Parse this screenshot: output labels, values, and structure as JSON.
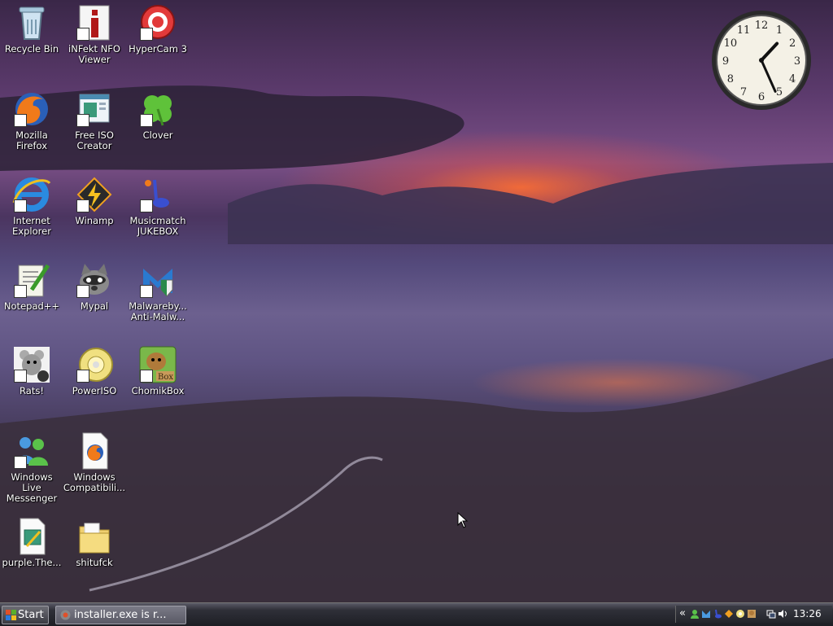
{
  "desktop": {
    "icons": [
      {
        "label": "Recycle Bin",
        "icon": "recycle-bin-icon"
      },
      {
        "label": "iNFekt NFO Viewer",
        "icon": "infekt-icon"
      },
      {
        "label": "HyperCam 3",
        "icon": "hypercam-icon"
      },
      {
        "label": "Mozilla Firefox",
        "icon": "firefox-icon"
      },
      {
        "label": "Free ISO Creator",
        "icon": "iso-creator-icon"
      },
      {
        "label": "Clover",
        "icon": "clover-icon"
      },
      {
        "label": "Internet Explorer",
        "icon": "internet-explorer-icon"
      },
      {
        "label": "Winamp",
        "icon": "winamp-icon"
      },
      {
        "label": "Musicmatch JUKEBOX",
        "icon": "musicmatch-icon"
      },
      {
        "label": "Notepad++",
        "icon": "notepadpp-icon"
      },
      {
        "label": "Mypal",
        "icon": "mypal-icon"
      },
      {
        "label": "Malwareby... Anti-Malw...",
        "icon": "malwarebytes-icon"
      },
      {
        "label": "Rats!",
        "icon": "rats-icon"
      },
      {
        "label": "PowerISO",
        "icon": "poweriso-icon"
      },
      {
        "label": "ChomikBox",
        "icon": "chomikbox-icon"
      },
      {
        "label": "Windows Live Messenger",
        "icon": "messenger-icon"
      },
      {
        "label": "Windows Compatibili...",
        "icon": "firefox-document-icon"
      },
      {
        "label": "purple.The...",
        "icon": "purple-document-icon"
      },
      {
        "label": "shitufck",
        "icon": "folder-icon"
      }
    ]
  },
  "clock": {
    "numerals": [
      "12",
      "1",
      "2",
      "3",
      "4",
      "5",
      "6",
      "7",
      "8",
      "9",
      "10",
      "11"
    ],
    "hour": 1,
    "minute": 26
  },
  "taskbar": {
    "start_label": "Start",
    "task_label": "installer.exe is r...",
    "tray_chevron": "«",
    "time": "13:26"
  },
  "colors": {
    "taskbar": "#1d1e24",
    "sky_glow": "#ff6e32"
  }
}
